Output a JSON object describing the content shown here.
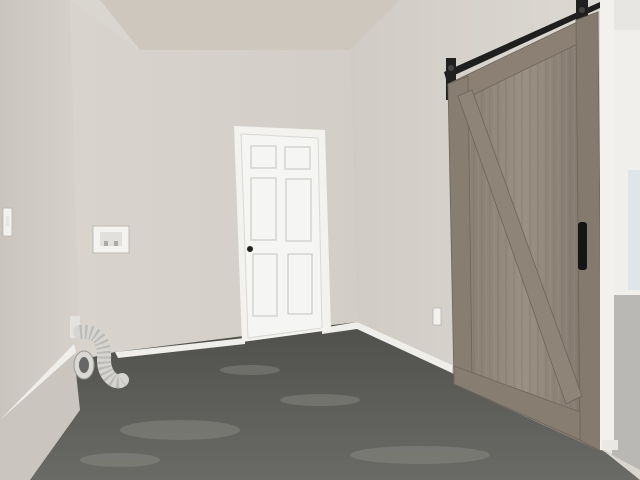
{
  "scene": {
    "description_tag": "room-interior",
    "colors": {
      "wall_left": "#cfcbc4",
      "wall_back": "#d8d4cd",
      "wall_right": "#d4d0c9",
      "ceiling": "#cdc7bd",
      "floor": "#5a5a57",
      "trim": "#f2f1ee",
      "door": "#f4f4f2",
      "barn_door_wood": "#8e8276",
      "barn_door_dark": "#6e645a",
      "rail": "#1e1e1e"
    },
    "objects": [
      "interior-door",
      "barn-door",
      "barn-door-rail",
      "washer-box",
      "dryer-vent-hose",
      "light-switch",
      "wall-outlet"
    ]
  }
}
